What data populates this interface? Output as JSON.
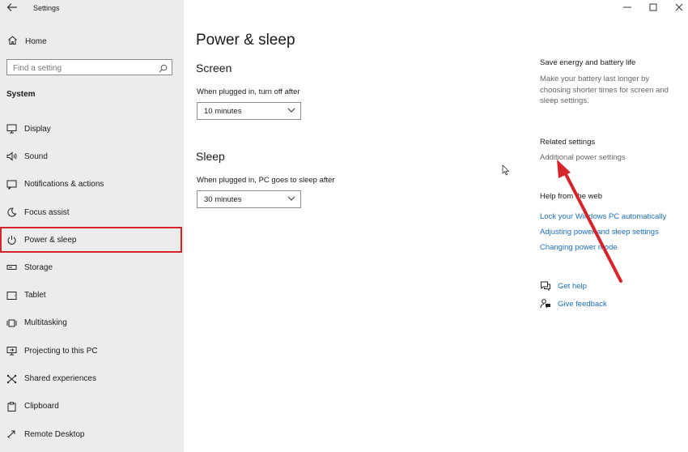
{
  "window": {
    "title": "Settings"
  },
  "sidebar": {
    "home_label": "Home",
    "search_placeholder": "Find a setting",
    "section_label": "System",
    "items": [
      {
        "label": "Display",
        "icon": "monitor-icon"
      },
      {
        "label": "Sound",
        "icon": "speaker-icon"
      },
      {
        "label": "Notifications & actions",
        "icon": "notification-icon"
      },
      {
        "label": "Focus assist",
        "icon": "moon-icon"
      },
      {
        "label": "Power & sleep",
        "icon": "power-icon",
        "selected": true
      },
      {
        "label": "Storage",
        "icon": "storage-icon"
      },
      {
        "label": "Tablet",
        "icon": "tablet-icon"
      },
      {
        "label": "Multitasking",
        "icon": "multitasking-icon"
      },
      {
        "label": "Projecting to this PC",
        "icon": "projecting-icon"
      },
      {
        "label": "Shared experiences",
        "icon": "shared-experiences-icon"
      },
      {
        "label": "Clipboard",
        "icon": "clipboard-icon"
      },
      {
        "label": "Remote Desktop",
        "icon": "remote-desktop-icon"
      }
    ]
  },
  "main": {
    "title": "Power & sleep",
    "screen": {
      "heading": "Screen",
      "label": "When plugged in, turn off after",
      "value": "10 minutes"
    },
    "sleep": {
      "heading": "Sleep",
      "label": "When plugged in, PC goes to sleep after",
      "value": "30 minutes"
    }
  },
  "right_panel": {
    "save_energy_heading": "Save energy and battery life",
    "save_energy_text": "Make your battery last longer by choosing shorter times for screen and sleep settings.",
    "related_heading": "Related settings",
    "additional_power_link": "Additional power settings",
    "help_heading": "Help from the web",
    "help_links": [
      "Lock your Windows PC automatically",
      "Adjusting power and sleep settings",
      "Changing power mode"
    ],
    "get_help": "Get help",
    "give_feedback": "Give feedback"
  },
  "colors": {
    "sidebar_bg": "#ececec",
    "link": "#1a6fbf",
    "highlight_box": "#d7232a",
    "annotation_arrow": "#d7232a"
  }
}
